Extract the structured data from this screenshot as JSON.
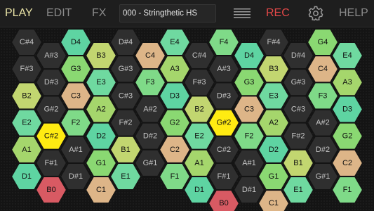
{
  "toolbar": {
    "play_label": "PLAY",
    "edit_label": "EDIT",
    "fx_label": "FX",
    "preset_name": "000 - Stringthetic HS",
    "rec_label": "REC",
    "help_label": "HELP",
    "menu_icon": "hamburger-menu-icon",
    "settings_icon": "gear-icon"
  },
  "colors": {
    "accent_active_tab": "#e9e3a6",
    "inactive_tab": "#8a8a8a",
    "rec": "#e34848",
    "highlight": "#ffeb12",
    "D": "#5ed4a2",
    "E": "#6fd9a0",
    "F": "#7fda88",
    "G": "#8ad872",
    "A": "#a5d66c",
    "B": "#c2d670",
    "C": "#ddb588",
    "C0": "#d85a63",
    "sharp": "#2f2f2f"
  },
  "grid": {
    "columns": [
      [
        "C#4",
        "F#3",
        "B2",
        "E2",
        "A1",
        "D1"
      ],
      [
        "A#3",
        "D#3",
        "G#2",
        "C#2",
        "F#1",
        "B0"
      ],
      [
        "D4",
        "G3",
        "C3",
        "F2",
        "A#1",
        "D#1"
      ],
      [
        "B3",
        "E3",
        "A2",
        "D2",
        "G1",
        "C1"
      ],
      [
        "D#4",
        "G#3",
        "C#3",
        "F#2",
        "B1",
        "E1"
      ],
      [
        "C4",
        "F3",
        "A#2",
        "D#2",
        "G#1"
      ],
      [
        "E4",
        "A3",
        "D3",
        "G2",
        "C2",
        "F1"
      ],
      [
        "C#4",
        "F#3",
        "B2",
        "E2",
        "A1",
        "D1"
      ],
      [
        "F4",
        "A#3",
        "D#3",
        "G#2",
        "C#2",
        "F#1",
        "B0"
      ],
      [
        "D4",
        "G3",
        "C3",
        "F2",
        "A#1",
        "D#1"
      ],
      [
        "F#4",
        "B3",
        "E3",
        "A2",
        "D2",
        "G1",
        "C1"
      ],
      [
        "D#4",
        "G#3",
        "C#3",
        "F#2",
        "B1",
        "E1"
      ],
      [
        "G4",
        "C4",
        "F3",
        "A#2",
        "D#2",
        "G#1"
      ],
      [
        "E4",
        "A3",
        "D3",
        "G2",
        "C2",
        "F1"
      ]
    ]
  }
}
